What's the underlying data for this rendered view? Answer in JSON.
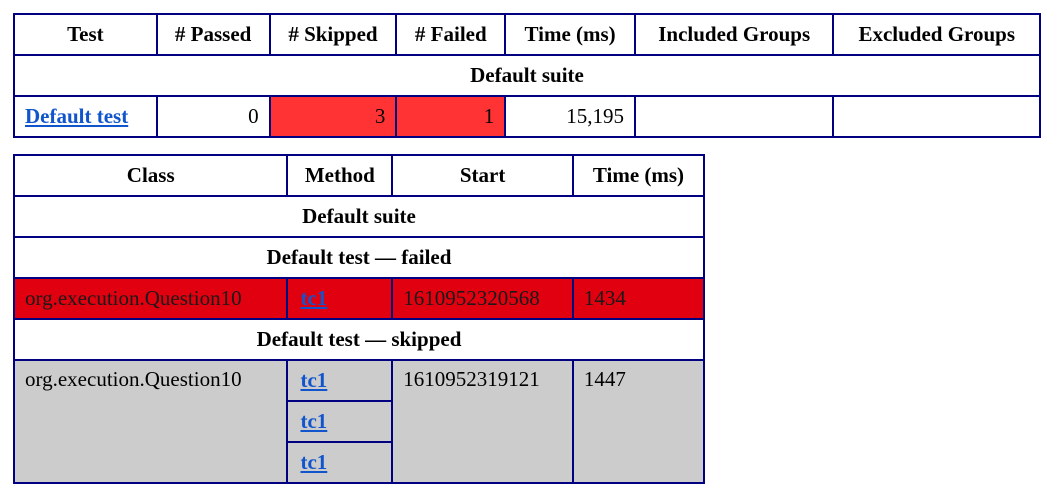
{
  "overview": {
    "headers": [
      "Test",
      "# Passed",
      "# Skipped",
      "# Failed",
      "Time (ms)",
      "Included Groups",
      "Excluded Groups"
    ],
    "suite_title": "Default suite",
    "row": {
      "test": "Default test",
      "passed": "0",
      "skipped": "3",
      "failed": "1",
      "time": "15,195",
      "included": "",
      "excluded": ""
    }
  },
  "methods": {
    "headers": [
      "Class",
      "Method",
      "Start",
      "Time (ms)"
    ],
    "suite_title": "Default suite",
    "failed_title": "Default test — failed",
    "failed_row": {
      "class": "org.execution.Question10",
      "method": "tc1",
      "start": "1610952320568",
      "time": "1434"
    },
    "skipped_title": "Default test — skipped",
    "skipped_row": {
      "class": "org.execution.Question10",
      "methods": [
        "tc1",
        "tc1",
        "tc1"
      ],
      "start": "1610952319121",
      "time": "1447"
    }
  },
  "colors": {
    "border": "#000080",
    "attention": "#ff3333",
    "failed_row": "#e0000f",
    "skipped_row": "#cccccc",
    "link": "#1155cc"
  }
}
